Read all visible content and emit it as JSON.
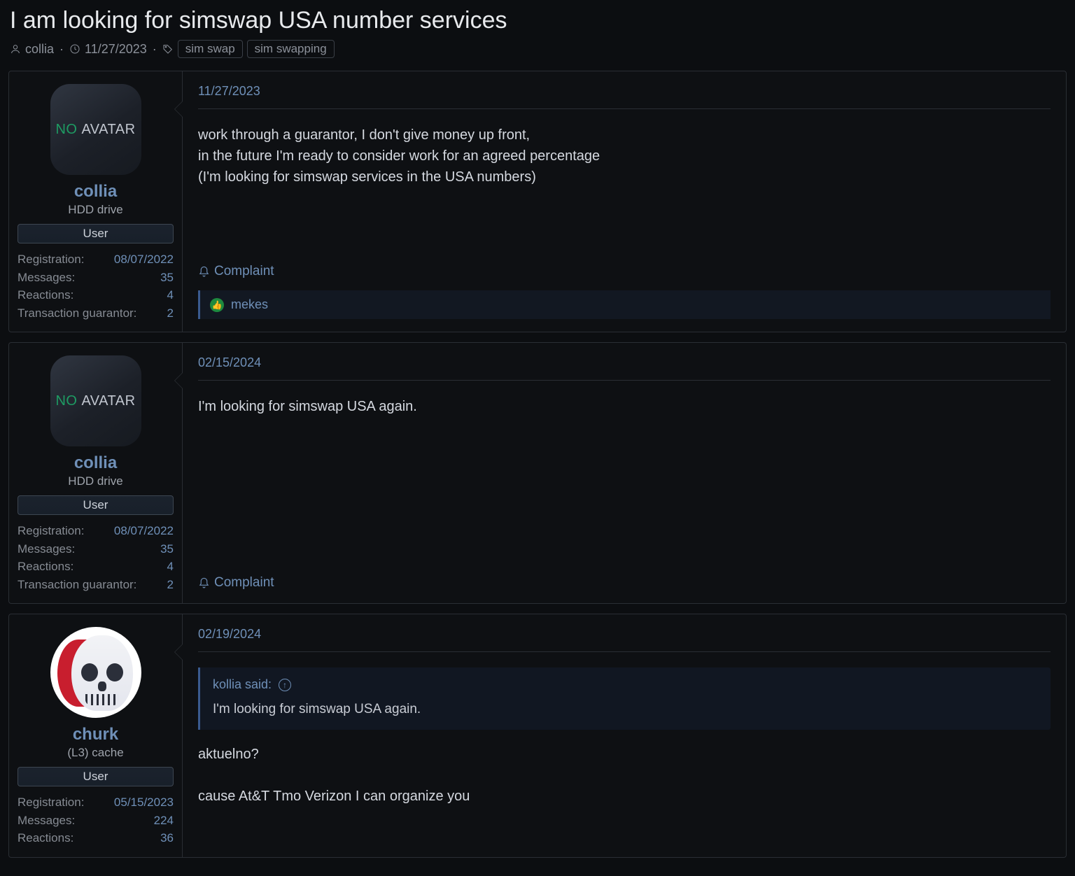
{
  "thread": {
    "title": "I am looking for simswap USA number services",
    "author": "collia",
    "date": "11/27/2023",
    "tags": [
      "sim swap",
      "sim swapping"
    ]
  },
  "labels": {
    "complaint": "Complaint",
    "user_role": "User",
    "registration": "Registration:",
    "messages": "Messages:",
    "reactions": "Reactions:",
    "guarantor": "Transaction guarantor:",
    "no": "NO",
    "avatar": "AVATAR"
  },
  "posts": [
    {
      "user": {
        "name": "collia",
        "title": "HDD drive",
        "avatar_type": "none",
        "stats": {
          "registration": "08/07/2022",
          "messages": "35",
          "reactions": "4",
          "guarantor": "2"
        }
      },
      "date": "11/27/2023",
      "body": "work through a guarantor, I don't give money up front,\nin the future I'm ready to consider work for an agreed percentage\n(I'm looking for simswap services in the USA numbers)",
      "reactions": {
        "user": "mekes"
      }
    },
    {
      "user": {
        "name": "collia",
        "title": "HDD drive",
        "avatar_type": "none",
        "stats": {
          "registration": "08/07/2022",
          "messages": "35",
          "reactions": "4",
          "guarantor": "2"
        }
      },
      "date": "02/15/2024",
      "body": "I'm looking for simswap USA again."
    },
    {
      "user": {
        "name": "churk",
        "title": "(L3) cache",
        "avatar_type": "skull",
        "stats": {
          "registration": "05/15/2023",
          "messages": "224",
          "reactions": "36"
        }
      },
      "date": "02/19/2024",
      "quote": {
        "head": "kollia said:",
        "body": "I'm looking for simswap USA again."
      },
      "body": "aktuelno?\n\ncause At&T Tmo Verizon I can organize you"
    }
  ]
}
